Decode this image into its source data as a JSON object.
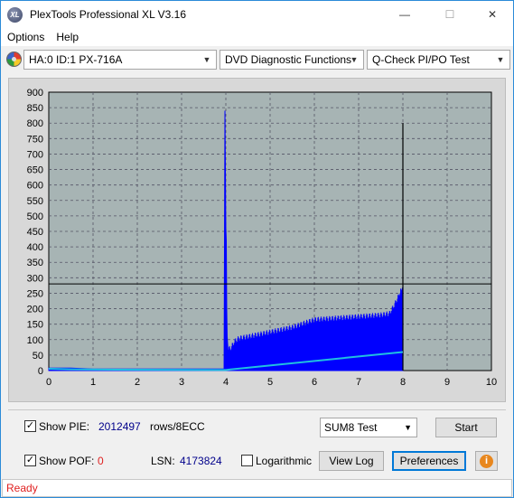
{
  "window": {
    "title": "PlexTools Professional XL V3.16",
    "icon_text": "XL",
    "minimize_glyph": "—",
    "maximize_glyph": "☐",
    "close_glyph": "✕"
  },
  "menu": {
    "options": "Options",
    "help": "Help"
  },
  "toolbar": {
    "drive": "HA:0 ID:1  PX-716A",
    "function": "DVD Diagnostic Functions",
    "test": "Q-Check PI/PO Test",
    "dropdown_glyph": "▼"
  },
  "chart_data": {
    "type": "area",
    "xlim": [
      0,
      10
    ],
    "ylim": [
      0,
      900
    ],
    "x_ticks": [
      "0",
      "1",
      "2",
      "3",
      "4",
      "5",
      "6",
      "7",
      "8",
      "9",
      "10"
    ],
    "y_ticks": [
      "0",
      "50",
      "100",
      "150",
      "200",
      "250",
      "300",
      "350",
      "400",
      "450",
      "500",
      "550",
      "600",
      "650",
      "700",
      "750",
      "800",
      "850",
      "900"
    ],
    "grid": true,
    "threshold_line": 280,
    "pie_series": {
      "color": "#0000ff",
      "x": [
        0.0,
        0.5,
        1.0,
        1.5,
        2.0,
        2.5,
        3.0,
        3.5,
        3.9,
        3.96,
        3.98,
        4.0,
        4.01,
        4.02,
        4.03,
        4.05,
        4.1,
        4.2,
        4.3,
        4.5,
        5.0,
        5.5,
        6.0,
        6.5,
        7.0,
        7.5,
        7.7,
        7.8,
        7.9,
        7.95,
        8.0
      ],
      "y": [
        8,
        8,
        5,
        5,
        5,
        5,
        5,
        5,
        5,
        5,
        840,
        460,
        420,
        200,
        110,
        65,
        60,
        85,
        95,
        100,
        115,
        130,
        155,
        160,
        165,
        170,
        175,
        200,
        230,
        250,
        270
      ]
    },
    "pif_total_spike": {
      "x": 8.0,
      "y": 800,
      "color": "#000000"
    },
    "pif_series": {
      "color": "#20c0e0",
      "x": [
        0.0,
        0.5,
        1.5,
        4.0,
        8.0
      ],
      "y": [
        6,
        4,
        3,
        2,
        60
      ]
    }
  },
  "bottom": {
    "show_pie_label": "Show PIE:",
    "pie_value": "2012497",
    "pie_unit": "rows/8ECC",
    "show_pof_label": "Show POF:",
    "pof_value": "0",
    "lsn_label": "LSN:",
    "lsn_value": "4173824",
    "logarithmic_label": "Logarithmic",
    "test_select": "SUM8 Test",
    "start_button": "Start",
    "view_log_button": "View Log",
    "preferences_button": "Preferences",
    "check_glyph": "✓",
    "info_glyph": "i"
  },
  "status": {
    "text": "Ready"
  },
  "colors": {
    "plot_background": "#a7b4b4",
    "pie": "#0000ff",
    "pif": "#20c0e0",
    "value_text": "#00008b",
    "pof_value": "#e02020",
    "status_text": "#e02020"
  }
}
